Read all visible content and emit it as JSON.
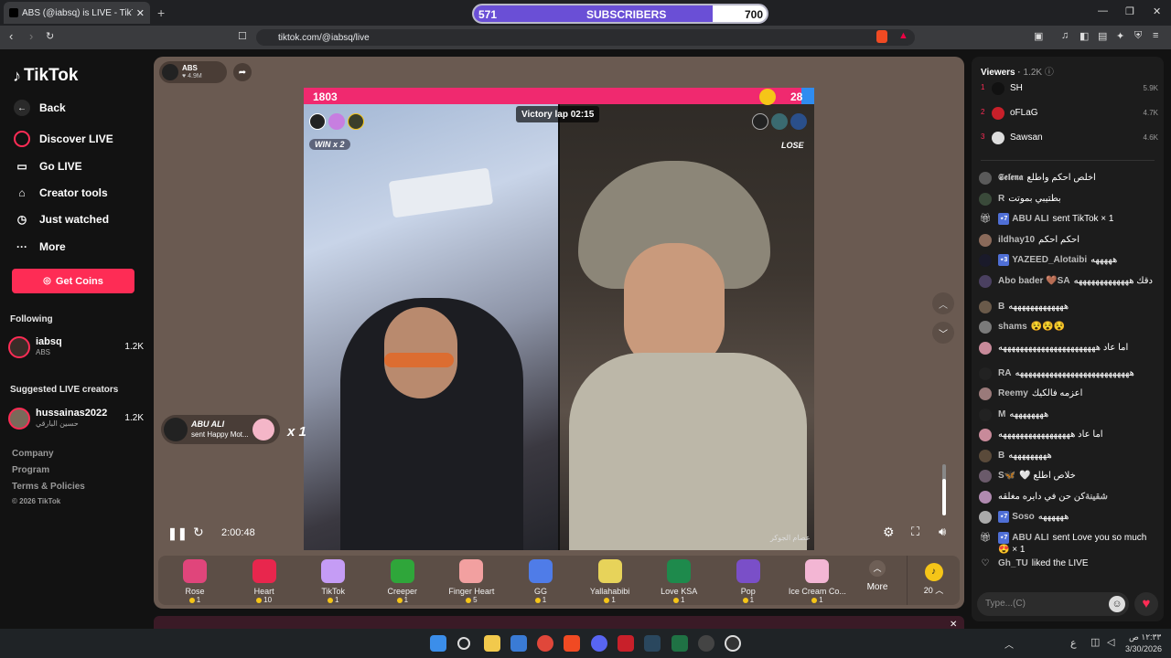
{
  "browser": {
    "tab_title": "ABS (@iabsq) is LIVE - TikTok",
    "url": "tiktok.com/@iabsq/live",
    "subscriber_bar": {
      "left_value": "571",
      "label": "SUBSCRIBERS",
      "right_value": "700",
      "progress": 0.816
    }
  },
  "sidebar": {
    "logo": "TikTok",
    "back": "Back",
    "nav": [
      "Discover LIVE",
      "Go LIVE",
      "Creator tools",
      "Just watched",
      "More"
    ],
    "get_coins": "Get Coins",
    "following_title": "Following",
    "following": [
      {
        "name": "iabsq",
        "sub": "ABS",
        "count": "1.2K"
      }
    ],
    "suggested_title": "Suggested LIVE creators",
    "suggested": [
      {
        "name": "hussainas2022",
        "sub": "حسين البارقي",
        "count": "1.2K"
      }
    ],
    "footer": [
      "Company",
      "Program",
      "Terms & Policies",
      "© 2026 TikTok"
    ]
  },
  "player": {
    "host_name": "ABS",
    "host_likes": "♥ 4.9M",
    "score_left": "1803",
    "score_right": "28",
    "battle_timer": "Victory lap 02:15",
    "win_label": "WIN x 2",
    "lose_label": "LOSE",
    "elapsed": "2:00:48",
    "watermark": "عصام الجوكر",
    "gift_toast": {
      "user": "ABU ALI",
      "text": "sent Happy Mot...",
      "multiplier": "x 1"
    }
  },
  "gifts": [
    {
      "name": "Rose",
      "price": "1",
      "icon": "rose-icon",
      "color": "#e0457b"
    },
    {
      "name": "Heart",
      "price": "10",
      "icon": "heart-icon",
      "color": "#e8264d"
    },
    {
      "name": "TikTok",
      "price": "1",
      "icon": "tiktok-note-icon",
      "color": "#c59cf5"
    },
    {
      "name": "Creeper",
      "price": "1",
      "icon": "creeper-icon",
      "color": "#2fa63a"
    },
    {
      "name": "Finger Heart",
      "price": "5",
      "icon": "finger-heart-icon",
      "color": "#f2a0a0"
    },
    {
      "name": "GG",
      "price": "1",
      "icon": "gg-icon",
      "color": "#4f7ce8"
    },
    {
      "name": "Yallahabibi",
      "price": "1",
      "icon": "yallahabibi-icon",
      "color": "#e7d35a"
    },
    {
      "name": "Love KSA",
      "price": "1",
      "icon": "love-ksa-icon",
      "color": "#1e8a4c"
    },
    {
      "name": "Pop",
      "price": "1",
      "icon": "pop-icon",
      "color": "#7a4fc8"
    },
    {
      "name": "Ice Cream Co...",
      "price": "1",
      "icon": "ice-cream-icon",
      "color": "#f3b6d4"
    }
  ],
  "gift_more": "More",
  "coin_balance": "20",
  "chat": {
    "viewers_label": "Viewers",
    "viewers_count": "1.2K",
    "top_viewers": [
      {
        "rank": "1",
        "name": "SH",
        "score": "5.9K",
        "color": "#111111"
      },
      {
        "rank": "2",
        "name": "oFLaG",
        "score": "4.7K",
        "color": "#c8202a"
      },
      {
        "rank": "3",
        "name": "Sawsan",
        "score": "4.6K",
        "color": "#dddddd"
      }
    ],
    "messages": [
      {
        "user": "𝕾𝖊𝖑𝖊𝖓𝖆",
        "badge": "",
        "text": "اخلص احكم واطلع",
        "type": "chat"
      },
      {
        "user": "R",
        "badge": "",
        "text": "بطتيبي بموتت",
        "type": "chat"
      },
      {
        "user": "ABU ALI",
        "badge": "7",
        "text": "sent TikTok × 1",
        "type": "gift"
      },
      {
        "user": "ildhay10",
        "badge": "",
        "text": "احكم احكم",
        "type": "chat"
      },
      {
        "user": "YAZEED_Alotaibi",
        "badge": "3",
        "text": "هههههه",
        "type": "chat"
      },
      {
        "user": "Abo bader 🤎SA",
        "badge": "",
        "text": "دقك هههههههههههههه",
        "type": "chat"
      },
      {
        "user": "B",
        "badge": "",
        "text": "هههههههههههههه",
        "type": "chat"
      },
      {
        "user": "shams",
        "badge": "",
        "text": "😵😵😵",
        "type": "chat"
      },
      {
        "user": "",
        "badge": "",
        "text": "اما عاد هههههههههههههههههههههههه",
        "type": "chat"
      },
      {
        "user": "RA",
        "badge": "",
        "text": "هههههههههههههههههههههههههههه",
        "type": "chat"
      },
      {
        "user": "Reemy",
        "badge": "",
        "text": "اعزمه فالكيك",
        "type": "chat"
      },
      {
        "user": "M",
        "badge": "",
        "text": "ههههههههه",
        "type": "chat"
      },
      {
        "user": "",
        "badge": "",
        "text": "اما عاد هههههههههههههههههه",
        "type": "chat"
      },
      {
        "user": "B",
        "badge": "",
        "text": "هههههههههه",
        "type": "chat"
      },
      {
        "user": "S🦋",
        "badge": "",
        "text": "🤍 خلاص اطلع",
        "type": "chat"
      },
      {
        "user": "شقينة",
        "badge": "",
        "text": "كن حن في دايره مغلقه",
        "type": "chat"
      },
      {
        "user": "Soso",
        "badge": "7",
        "text": "ههههههه",
        "type": "chat"
      },
      {
        "user": "ABU ALI",
        "badge": "7",
        "text": "sent Love you so much 😍 × 1",
        "type": "gift"
      },
      {
        "user": "Gh_TU",
        "badge": "",
        "text": "liked the LIVE",
        "type": "like"
      }
    ],
    "input_placeholder": "Type...(C)"
  },
  "taskbar": {
    "time": "١٢:٣٣ ص",
    "date": "3/30/2026",
    "lang": "ع"
  }
}
